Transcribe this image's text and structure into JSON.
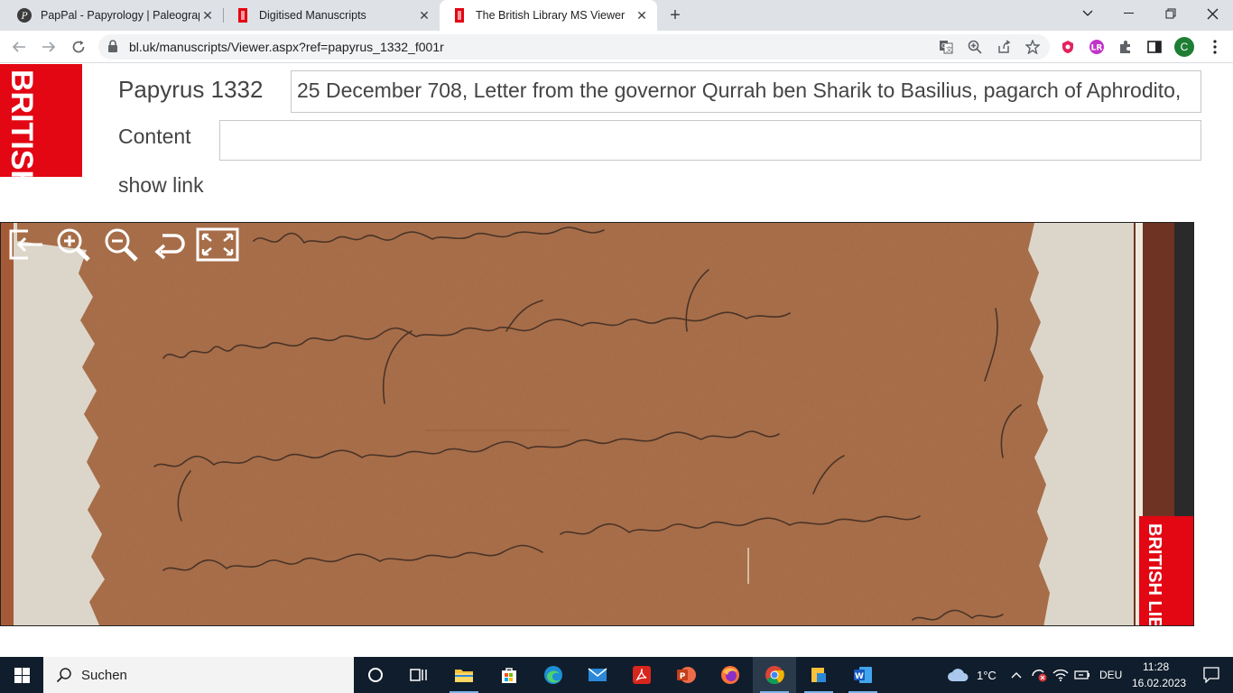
{
  "browser": {
    "tabs": [
      {
        "title": "PapPal - Papyrology | Paleograph",
        "favicon": "pappal-icon"
      },
      {
        "title": "Digitised Manuscripts",
        "favicon": "british-library-favicon"
      },
      {
        "title": "The British Library MS Viewer",
        "favicon": "british-library-favicon"
      }
    ],
    "url": "bl.uk/manuscripts/Viewer.aspx?ref=papyrus_1332_f001r",
    "profile_initial": "C",
    "colors": {
      "tabbar": "#dee1e6",
      "profile": "#1e7e34",
      "accent_red": "#e30613"
    }
  },
  "page": {
    "logo_text": "BRITISH LIBRARY",
    "ms_title": "Papyrus 1332",
    "title_value": "25 December 708, Letter from the governor Qurrah ben Sharik to Basilius, pagarch of Aphrodito,",
    "content_label": "Content",
    "content_value": "",
    "show_link": "show link",
    "viewer_logo_text": "BRITISH LIBRARY",
    "viewer_tools": [
      "exit-icon",
      "zoom-in-icon",
      "zoom-out-icon",
      "rotate-icon",
      "fullscreen-icon"
    ]
  },
  "taskbar": {
    "search_placeholder": "Suchen",
    "weather": "1°C",
    "language": "DEU",
    "time": "11:28",
    "date": "16.02.2023"
  }
}
